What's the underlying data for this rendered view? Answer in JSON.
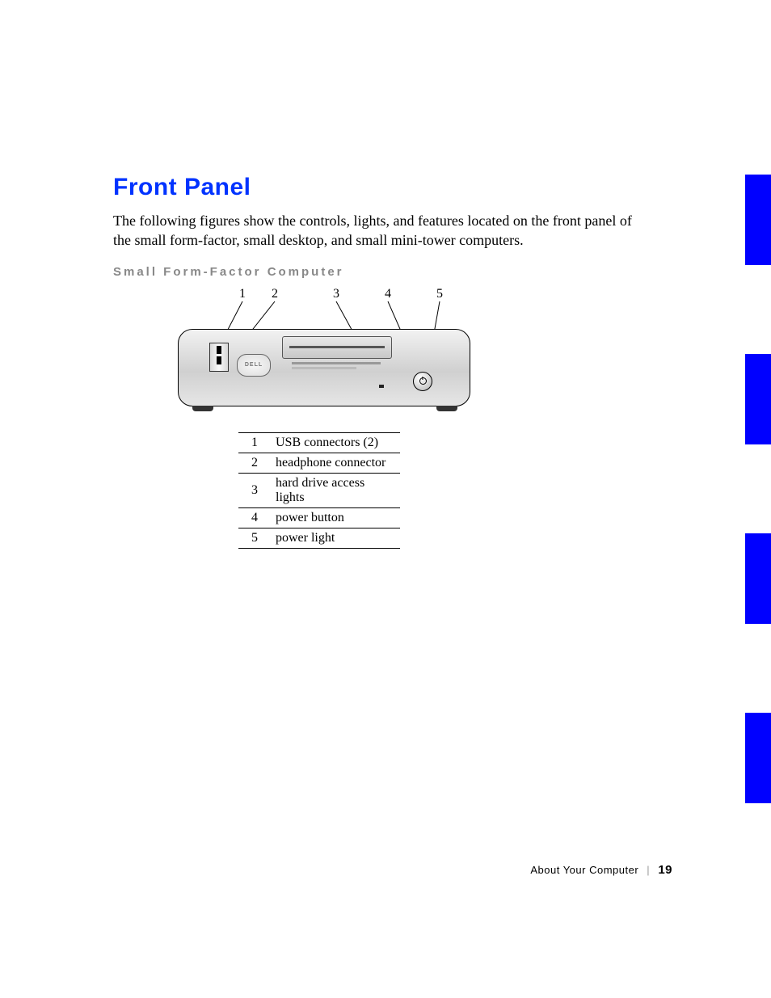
{
  "heading": "Front Panel",
  "intro": "The following figures show the controls, lights, and features located on the front panel of the small form-factor, small desktop, and small mini-tower computers.",
  "subheading": "Small Form-Factor Computer",
  "diagram": {
    "brand_label": "DELL",
    "callouts": [
      "1",
      "2",
      "3",
      "4",
      "5"
    ]
  },
  "legend": [
    {
      "num": "1",
      "label": "USB connectors (2)"
    },
    {
      "num": "2",
      "label": "headphone connector"
    },
    {
      "num": "3",
      "label": "hard drive access lights"
    },
    {
      "num": "4",
      "label": "power button"
    },
    {
      "num": "5",
      "label": "power light"
    }
  ],
  "footer": {
    "section": "About Your Computer",
    "page": "19"
  }
}
